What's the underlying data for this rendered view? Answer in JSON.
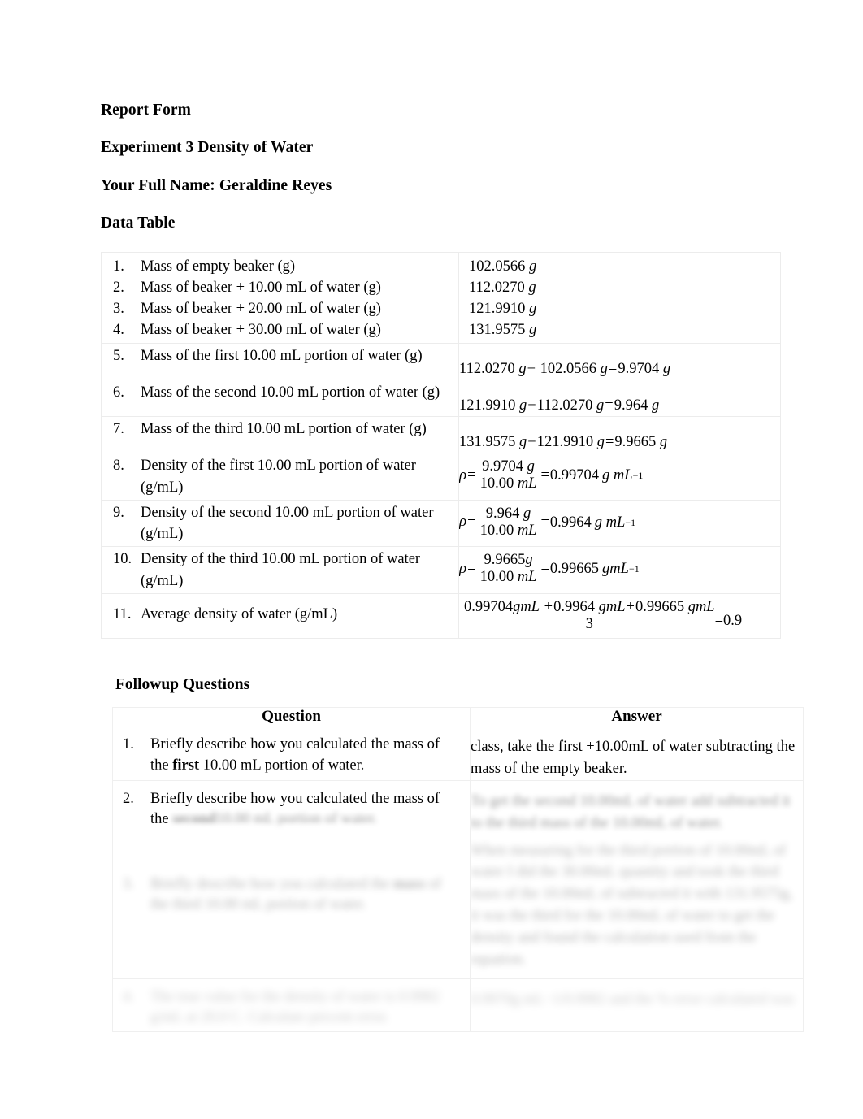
{
  "document": {
    "title": "Report Form",
    "experiment": "Experiment 3 Density of Water",
    "name_line": "Your Full Name: Geraldine Reyes",
    "data_table_heading": "Data Table",
    "followup_heading": "Followup Questions"
  },
  "data_table": {
    "items": [
      {
        "num": "1.",
        "label": "Mass of empty beaker (g)"
      },
      {
        "num": "2.",
        "label": "Mass of beaker + 10.00 mL of water (g)"
      },
      {
        "num": "3.",
        "label": "Mass of beaker + 20.00 mL of water (g)"
      },
      {
        "num": "4.",
        "label": "Mass of beaker + 30.00 mL of water (g)"
      },
      {
        "num": "5.",
        "label": "Mass of the first 10.00 mL portion of water (g)"
      },
      {
        "num": "6.",
        "label": "Mass of the second 10.00 mL portion of water (g)"
      },
      {
        "num": "7.",
        "label": "Mass of the third 10.00 mL portion of water (g)"
      },
      {
        "num": "8.",
        "label": "Density of the first 10.00 mL portion of water  (g/mL)"
      },
      {
        "num": "9.",
        "label": "Density of the second 10.00 mL portion of water (g/mL)"
      },
      {
        "num": "10.",
        "label": "Density of the third 10.00 mL portion of water (g/mL)"
      },
      {
        "num": "11.",
        "label": "Average density of water (g/mL)"
      }
    ],
    "simple_values": [
      {
        "value": "102.0566",
        "unit": "g"
      },
      {
        "value": "112.0270",
        "unit": "g"
      },
      {
        "value": "121.9910",
        "unit": "g"
      },
      {
        "value": "131.9575",
        "unit": "g"
      }
    ],
    "mass_equations": [
      {
        "a": "112.0270",
        "a_unit": "g",
        "b": "102.0566",
        "b_unit": "g",
        "result": "9.9704",
        "result_unit": "g"
      },
      {
        "a": "121.9910",
        "a_unit": "g",
        "b": "112.0270",
        "b_unit": "g",
        "result": "9.964",
        "result_unit": "g"
      },
      {
        "a": "131.9575",
        "a_unit": "g",
        "b": "121.9910",
        "b_unit": "g",
        "result": "9.9665",
        "result_unit": "g"
      }
    ],
    "density_equations": [
      {
        "rho": "ρ",
        "numerator": "9.9704",
        "num_unit": "g",
        "denominator": "10.00",
        "den_unit": "mL",
        "result": "0.99704",
        "result_unit": "g mL",
        "exponent": "−1"
      },
      {
        "rho": "ρ",
        "numerator": "9.964",
        "num_unit": "g",
        "denominator": "10.00",
        "den_unit": "mL",
        "result": "0.9964",
        "result_unit": "g mL",
        "exponent": "−1"
      },
      {
        "rho": "ρ",
        "numerator": "9.9665",
        "num_unit": "g",
        "denominator": "10.00",
        "den_unit": "mL",
        "result": "0.99665",
        "result_unit": "gmL",
        "exponent": "−1"
      }
    ],
    "average_equation": {
      "term1": "0.99704",
      "term1_unit": "gmL",
      "term2": "0.9964",
      "term2_unit": "gmL",
      "term3": "0.99665",
      "term3_unit": "gmL",
      "divisor": "3",
      "plus": "+",
      "equals": "=",
      "result_clipped": "0.9"
    },
    "minus_sign": "−",
    "equals_sign": "="
  },
  "followup": {
    "headers": {
      "question": "Question",
      "answer": "Answer"
    },
    "rows": [
      {
        "num": "1.",
        "question_line1": "Briefly describe how you calculated the mass",
        "question_line2_a": "of the ",
        "question_line2_bold": "first",
        "question_line2_b": " 10.00 mL portion of water.",
        "answer": "class, take the first +10.00mL of water subtracting the mass of the empty beaker.",
        "blur": "b1"
      },
      {
        "num": "2.",
        "question_line1": "Briefly describe how you calculated the mass",
        "question_line2_a": "of the ",
        "question_line2_bold": "second",
        "question_line2_b": " 10.00 mL portion of water.",
        "answer": "To get the second 10.00mL of water add subtracted it to the third mass of the 10.00mL of water.",
        "blur": "b3"
      },
      {
        "num": "3.",
        "question_line1": "Briefly describe how you calculated the",
        "question_line2_a": "",
        "question_line2_bold": "mass",
        "question_line2_b": " of the third 10.00 mL portion of water.",
        "answer": "When measuring for the third portion of 10.00mL of water I did the 30.00mL quantity and took the third mass of the 10.00mL of subtracted it with 131.9575g, it was the third for the 10.00mL of water to get the density and found the calculation used from the equation.",
        "blur": "b4"
      },
      {
        "num": "4.",
        "question_line1": "The true value for the density of water is",
        "question_line2_a": "0.9982 g/mL at 20.0 C. Calculate  ",
        "question_line2_bold": "",
        "question_line2_b": "percent error.",
        "answer": "0.9970g mL−1/0.9982 and the % error calculated was",
        "blur": "b5"
      }
    ]
  },
  "colors": {
    "text": "#000000",
    "border": "#ececec",
    "background": "#ffffff"
  }
}
